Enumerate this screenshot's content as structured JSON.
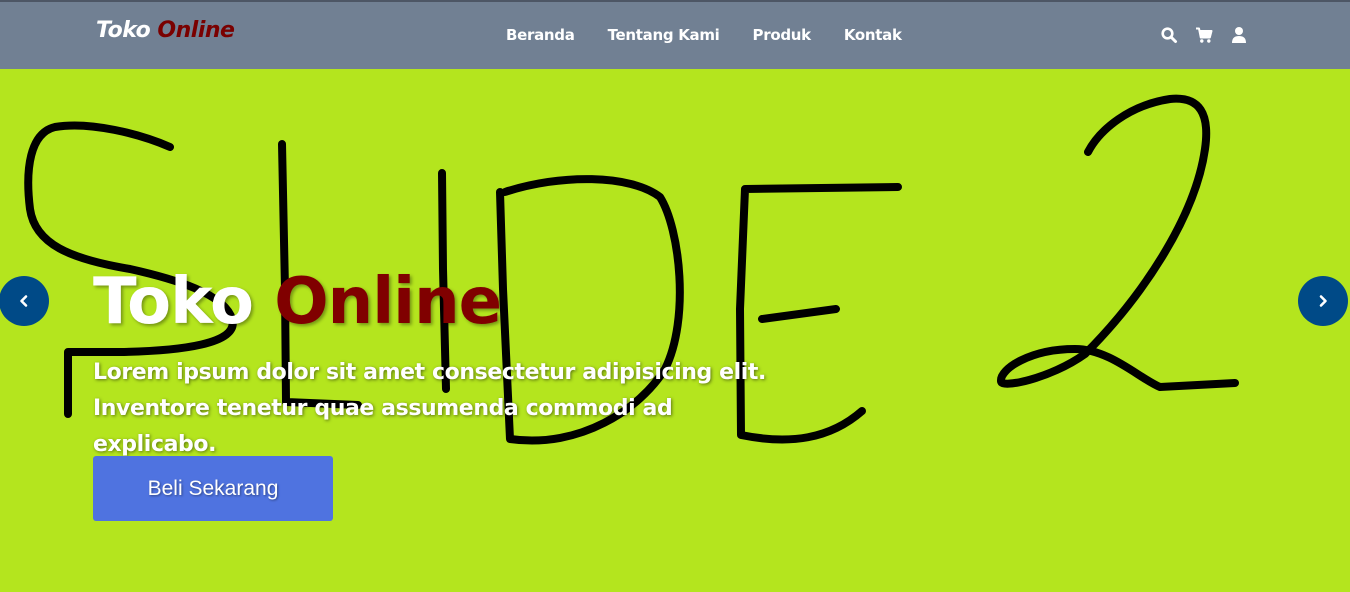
{
  "navbar": {
    "logo": {
      "part1": "Toko",
      "part2": "Online"
    },
    "links": [
      {
        "label": "Beranda"
      },
      {
        "label": "Tentang Kami"
      },
      {
        "label": "Produk"
      },
      {
        "label": "Kontak"
      }
    ],
    "icons": [
      "search-icon",
      "shopping-cart-icon",
      "user-icon"
    ]
  },
  "hero": {
    "slide_scribble_text": "SLIDE 2",
    "title_part1": "Toko",
    "title_part2": "Online",
    "description": "Lorem ipsum dolor sit amet consectetur adipisicing elit. Inventore tenetur quae assumenda commodi ad explicabo.",
    "cta_label": "Beli Sekarang",
    "arrows": [
      "chevron-left-icon",
      "chevron-right-icon"
    ]
  },
  "colors": {
    "navbar_bg": "#718093",
    "hero_bg": "#b4e51e",
    "brand_red": "#800000",
    "cta_blue": "#4f73e0",
    "arrow_blue": "#004a87"
  }
}
